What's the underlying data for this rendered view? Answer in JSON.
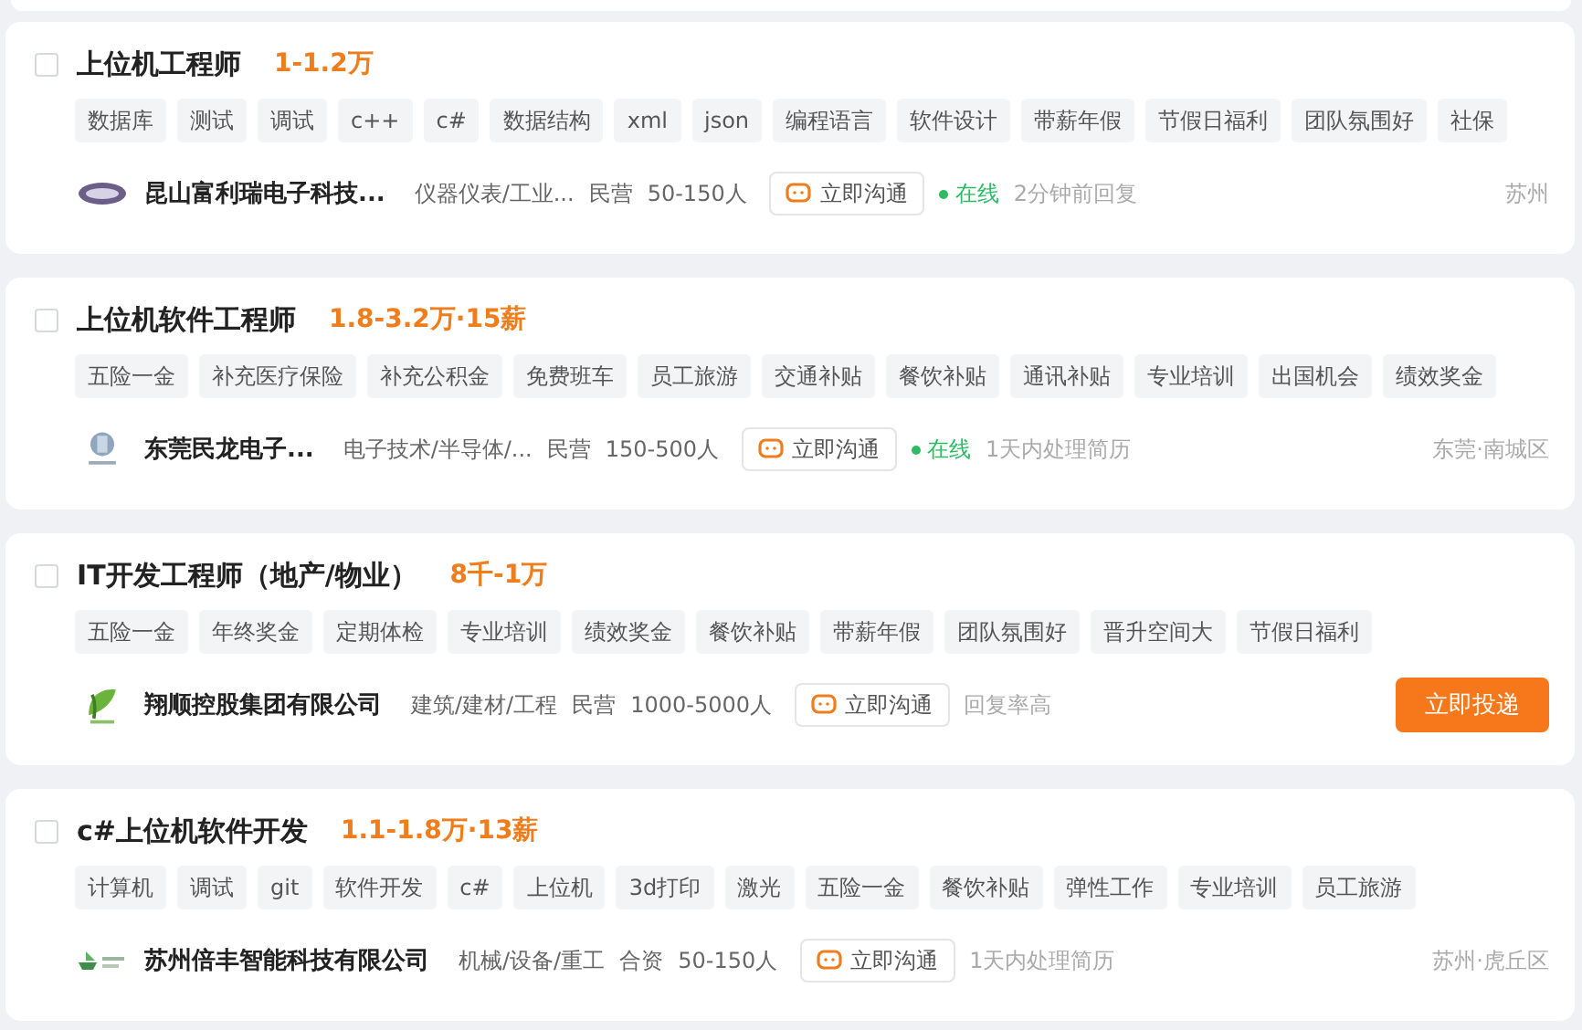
{
  "jobs": [
    {
      "checked": false,
      "title": "上位机工程师",
      "salary": "1-1.2万",
      "tags": [
        "数据库",
        "测试",
        "调试",
        "c++",
        "c#",
        "数据结构",
        "xml",
        "json",
        "编程语言",
        "软件设计",
        "带薪年假",
        "节假日福利",
        "团队氛围好",
        "社保"
      ],
      "company": "昆山富利瑞电子科技...",
      "logo": {
        "kind": "oval"
      },
      "industry": "仪器仪表/工业...",
      "ownership": "民营",
      "size": "50-150人",
      "chat": "立即沟通",
      "online": true,
      "online_label": "在线",
      "reply": "2分钟前回复",
      "location": "苏州"
    },
    {
      "checked": false,
      "title": "上位机软件工程师",
      "salary": "1.8-3.2万·15薪",
      "tags": [
        "五险一金",
        "补充医疗保险",
        "补充公积金",
        "免费班车",
        "员工旅游",
        "交通补贴",
        "餐饮补贴",
        "通讯补贴",
        "专业培训",
        "出国机会",
        "绩效奖金"
      ],
      "company": "东莞民龙电子...",
      "logo": {
        "kind": "badge"
      },
      "industry": "电子技术/半导体/...",
      "ownership": "民营",
      "size": "150-500人",
      "chat": "立即沟通",
      "online": true,
      "online_label": "在线",
      "reply": "1天内处理简历",
      "location": "东莞·南城区"
    },
    {
      "checked": false,
      "title": "IT开发工程师（地产/物业）",
      "salary": "8千-1万",
      "tags": [
        "五险一金",
        "年终奖金",
        "定期体检",
        "专业培训",
        "绩效奖金",
        "餐饮补贴",
        "带薪年假",
        "团队氛围好",
        "晋升空间大",
        "节假日福利"
      ],
      "company": "翔顺控股集团有限公司",
      "logo": {
        "kind": "leaf"
      },
      "industry": "建筑/建材/工程",
      "ownership": "民营",
      "size": "1000-5000人",
      "chat": "立即沟通",
      "online": false,
      "reply": "回复率高",
      "apply": "立即投递"
    },
    {
      "checked": false,
      "title": "c#上位机软件开发",
      "salary": "1.1-1.8万·13薪",
      "tags": [
        "计算机",
        "调试",
        "git",
        "软件开发",
        "c#",
        "上位机",
        "3d打印",
        "激光",
        "五险一金",
        "餐饮补贴",
        "弹性工作",
        "专业培训",
        "员工旅游"
      ],
      "company": "苏州倍丰智能科技有限公司",
      "logo": {
        "kind": "boat"
      },
      "industry": "机械/设备/重工",
      "ownership": "合资",
      "size": "50-150人",
      "chat": "立即沟通",
      "online": false,
      "reply": "1天内处理简历",
      "location": "苏州·虎丘区"
    }
  ]
}
